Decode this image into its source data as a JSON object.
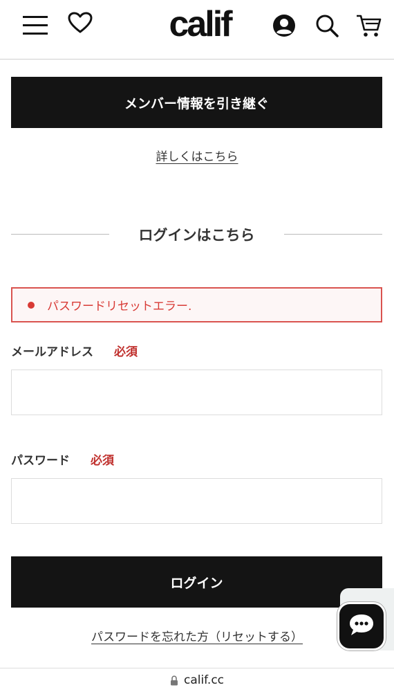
{
  "header": {
    "logo": "calif",
    "icons": [
      "menu-icon",
      "heart-icon",
      "account-icon",
      "search-icon",
      "cart-icon"
    ]
  },
  "member_transfer": {
    "button_label": "メンバー情報を引き継ぐ",
    "details_link": "詳しくはこちら"
  },
  "login": {
    "section_title": "ログインはこちら",
    "error_message": "パスワードリセットエラー.",
    "email_label": "メールアドレス",
    "email_required": "必須",
    "email_value": "",
    "password_label": "パスワード",
    "password_required": "必須",
    "password_value": "",
    "login_button": "ログイン",
    "forgot_link": "パスワードを忘れた方（リセットする）"
  },
  "browser": {
    "url": "calif.cc"
  },
  "colors": {
    "primary_dark": "#141414",
    "error_red": "#d83a35",
    "required_red": "#c0312e"
  }
}
